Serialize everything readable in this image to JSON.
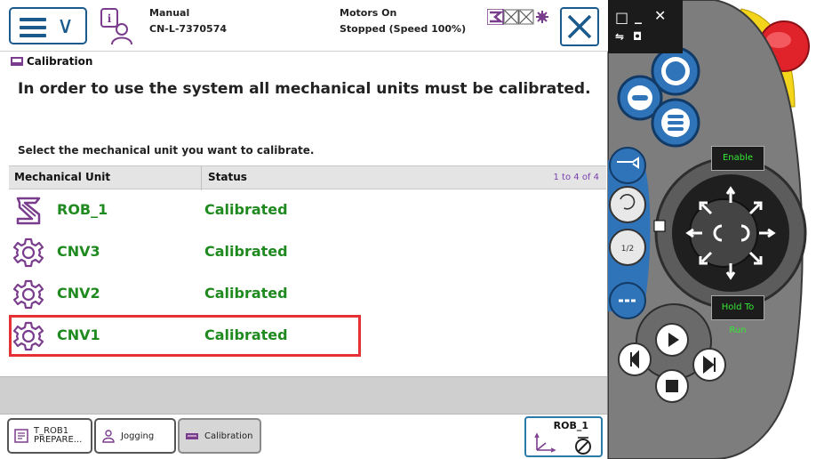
{
  "status": {
    "mode": "Manual",
    "system_name": "CN-L-7370574",
    "motors": "Motors On",
    "state": "Stopped (Speed 100%)"
  },
  "breadcrumb": "Calibration",
  "headline": "In order to use the system all mechanical units must be calibrated.",
  "instruction": "Select the mechanical unit you want to calibrate.",
  "table": {
    "columns": [
      "Mechanical Unit",
      "Status"
    ],
    "count": "1 to 4 of 4",
    "rows": [
      {
        "unit": "ROB_1",
        "status": "Calibrated",
        "icon": "robot-icon"
      },
      {
        "unit": "CNV3",
        "status": "Calibrated",
        "icon": "gear-icon"
      },
      {
        "unit": "CNV2",
        "status": "Calibrated",
        "icon": "gear-icon"
      },
      {
        "unit": "CNV1",
        "status": "Calibrated",
        "icon": "gear-icon",
        "selected": true
      }
    ]
  },
  "taskbar": {
    "task1_line1": "T_ROB1",
    "task1_line2": "PREPARE...",
    "jogging": "Jogging",
    "calibration": "Calibration",
    "robot_selector": "ROB_1"
  },
  "pendant": {
    "enable": "Enable",
    "hold_to_run": "Hold To Run"
  },
  "colors": {
    "accent_blue": "#1a5a8c",
    "calibrated_green": "#1f8a1f",
    "selection_red": "#e53036",
    "header_count_purple": "#7b3fb0",
    "pendant_gray": "#7d7d7d",
    "emergency_red": "#e0222a",
    "guard_yellow": "#f3d51b",
    "pendant_blue": "#2f73b8"
  }
}
